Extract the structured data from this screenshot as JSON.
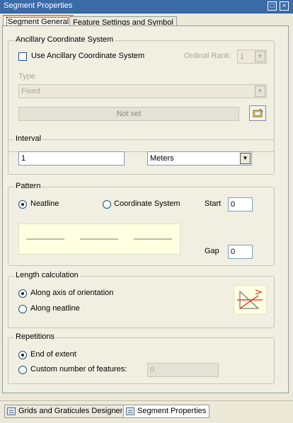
{
  "window": {
    "title": "Segment Properties",
    "pin_glyph": "□",
    "close_glyph": "×"
  },
  "tabs": [
    {
      "label": "Segment General"
    },
    {
      "label": "Feature Settings and Symbol"
    }
  ],
  "ancillary": {
    "group_label": "Ancillary Coordinate System",
    "checkbox_label": "Use Ancillary Coordinate System",
    "checked": false,
    "ordinal_rank_label": "Ordinal Rank:",
    "ordinal_rank_value": "1",
    "type_label": "Type",
    "type_value": "Fixed",
    "coord_system_value": "Not set"
  },
  "interval": {
    "group_label": "Interval",
    "value": "1",
    "units": "Meters"
  },
  "pattern": {
    "group_label": "Pattern",
    "option_neatline": "Neatline",
    "option_coordinate_system": "Coordinate System",
    "selected": "Neatline",
    "start_label": "Start",
    "start_value": "0",
    "gap_label": "Gap",
    "gap_value": "0",
    "preview_bg": "#ffffe1"
  },
  "length_calc": {
    "group_label": "Length calculation",
    "option_axis": "Along axis of orientation",
    "option_neatline": "Along neatline",
    "selected": "Along axis of orientation",
    "icon_name": "length-calculation-icon"
  },
  "repetitions": {
    "group_label": "Repetitions",
    "option_end": "End of extent",
    "option_custom": "Custom number of features:",
    "selected": "End of extent",
    "custom_value": "0"
  },
  "bottom_tabs": [
    {
      "label": "Grids and Graticules Designer"
    },
    {
      "label": "Segment Properties"
    }
  ],
  "colors": {
    "titlebar": "#3c6ca8",
    "active_tab_accent": "#e68b2c",
    "icon_red": "#d9261c"
  }
}
